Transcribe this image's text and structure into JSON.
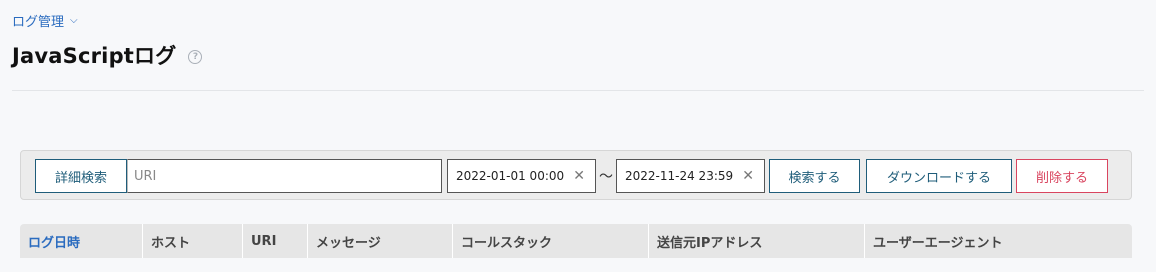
{
  "breadcrumb": {
    "label": "ログ管理"
  },
  "page": {
    "title": "JavaScriptログ",
    "help_glyph": "?"
  },
  "search": {
    "detail_button": "詳細検索",
    "uri_placeholder": "URI",
    "date_from": "2022-01-01 00:00",
    "date_to": "2022-11-24 23:59",
    "range_separator": "〜",
    "search_button": "検索する",
    "download_button": "ダウンロードする",
    "delete_button": "削除する"
  },
  "table": {
    "columns": [
      {
        "label": "ログ日時",
        "sorted": true
      },
      {
        "label": "ホスト",
        "sorted": false
      },
      {
        "label": "URI",
        "sorted": false
      },
      {
        "label": "メッセージ",
        "sorted": false
      },
      {
        "label": "コールスタック",
        "sorted": false
      },
      {
        "label": "送信元IPアドレス",
        "sorted": false
      },
      {
        "label": "ユーザーエージェント",
        "sorted": false
      }
    ]
  },
  "colors": {
    "accent": "#2a6bbf",
    "button_border": "#1f5d7a",
    "danger": "#d9455f"
  }
}
